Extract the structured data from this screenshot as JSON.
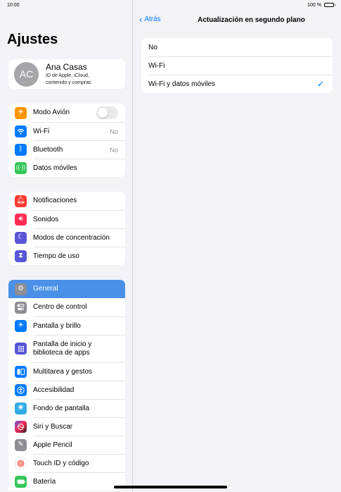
{
  "status": {
    "time": "10:00",
    "battery": "100 %"
  },
  "sidebar": {
    "title": "Ajustes",
    "profile": {
      "initials": "AC",
      "name": "Ana Casas",
      "subtitle_1": "ID de Apple, iCloud,",
      "subtitle_2": "contenido y compras"
    },
    "group1": [
      {
        "label": "Modo Avión",
        "icon": "airplane-icon",
        "color": "#ff9500"
      },
      {
        "label": "Wi-Fi",
        "value": "No",
        "icon": "wifi-icon",
        "color": "#007aff"
      },
      {
        "label": "Bluetooth",
        "value": "No",
        "icon": "bluetooth-icon",
        "color": "#007aff"
      },
      {
        "label": "Datos móviles",
        "icon": "antenna-icon",
        "color": "#34c759"
      }
    ],
    "group2": [
      {
        "label": "Notificaciones",
        "icon": "bell-icon",
        "color": "#ff3b30"
      },
      {
        "label": "Sonidos",
        "icon": "speaker-icon",
        "color": "#ff2d55"
      },
      {
        "label": "Modos de concentración",
        "icon": "moon-icon",
        "color": "#5856d6"
      },
      {
        "label": "Tiempo de uso",
        "icon": "hourglass-icon",
        "color": "#5856d6"
      }
    ],
    "group3": [
      {
        "label": "General",
        "icon": "gear-icon",
        "color": "#8e8e93"
      },
      {
        "label": "Centro de control",
        "icon": "switches-icon",
        "color": "#8e8e93"
      },
      {
        "label": "Pantalla y brillo",
        "icon": "sun-icon",
        "color": "#007aff"
      },
      {
        "label_1": "Pantalla de inicio y",
        "label_2": "biblioteca de apps",
        "icon": "grid-icon",
        "color": "#5856d6"
      },
      {
        "label": "Multitarea y gestos",
        "icon": "multitask-icon",
        "color": "#007aff"
      },
      {
        "label": "Accesibilidad",
        "icon": "accessibility-icon",
        "color": "#007aff"
      },
      {
        "label": "Fondo de pantalla",
        "icon": "flower-icon",
        "color": "#32ade6"
      },
      {
        "label": "Siri y Buscar",
        "icon": "siri-icon",
        "color": "#222222"
      },
      {
        "label": "Apple Pencil",
        "icon": "pencil-icon",
        "color": "#8e8e93"
      },
      {
        "label": "Touch ID y código",
        "icon": "fingerprint-icon",
        "color": "#ff3b30"
      },
      {
        "label": "Batería",
        "icon": "battery-icon",
        "color": "#34c759"
      }
    ]
  },
  "detail": {
    "back_label": "Atrás",
    "title": "Actualización en segundo plano",
    "options": [
      "No",
      "Wi-Fi",
      "Wi-Fi y datos móviles"
    ],
    "selected": 2
  },
  "colors": {
    "accent": "#007aff",
    "active_row": "#4a90e8"
  }
}
